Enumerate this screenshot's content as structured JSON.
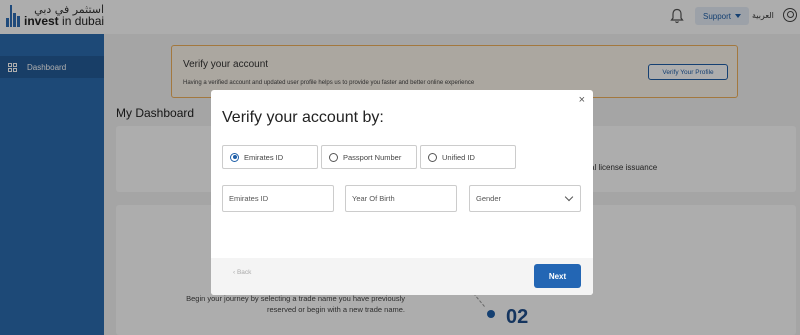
{
  "header": {
    "logo_ar": "استثمر في دبي",
    "logo_en_bold": "invest",
    "logo_en_rest": " in dubai",
    "support_label": "Support",
    "language_label": "العربية"
  },
  "sidebar": {
    "items": [
      {
        "label": "Dashboard",
        "icon": "grid-icon"
      }
    ]
  },
  "banner": {
    "title": "Verify your account",
    "text": "Having a verified account and updated user profile helps us to provide you faster and better online experience",
    "button_label": "Verify Your Profile",
    "border_color": "#f0b15c"
  },
  "main": {
    "title": "My Dashboard",
    "card1_text": "al license issuance",
    "journey_text": "Begin your journey by selecting a trade name you have previously reserved or begin with a new trade name.",
    "step_number": "02"
  },
  "modal": {
    "close": "×",
    "title": "Verify your account by:",
    "options": [
      {
        "label": "Emirates ID",
        "selected": true
      },
      {
        "label": "Passport Number",
        "selected": false
      },
      {
        "label": "Unified ID",
        "selected": false
      }
    ],
    "fields": {
      "emirates_id_placeholder": "Emirates ID",
      "dob_placeholder": "Year Of Birth",
      "gender_value": "Gender"
    },
    "back_label": "‹  Back",
    "next_label": "Next"
  },
  "colors": {
    "primary": "#2366b4",
    "sidebar": "#2b6cb0"
  }
}
